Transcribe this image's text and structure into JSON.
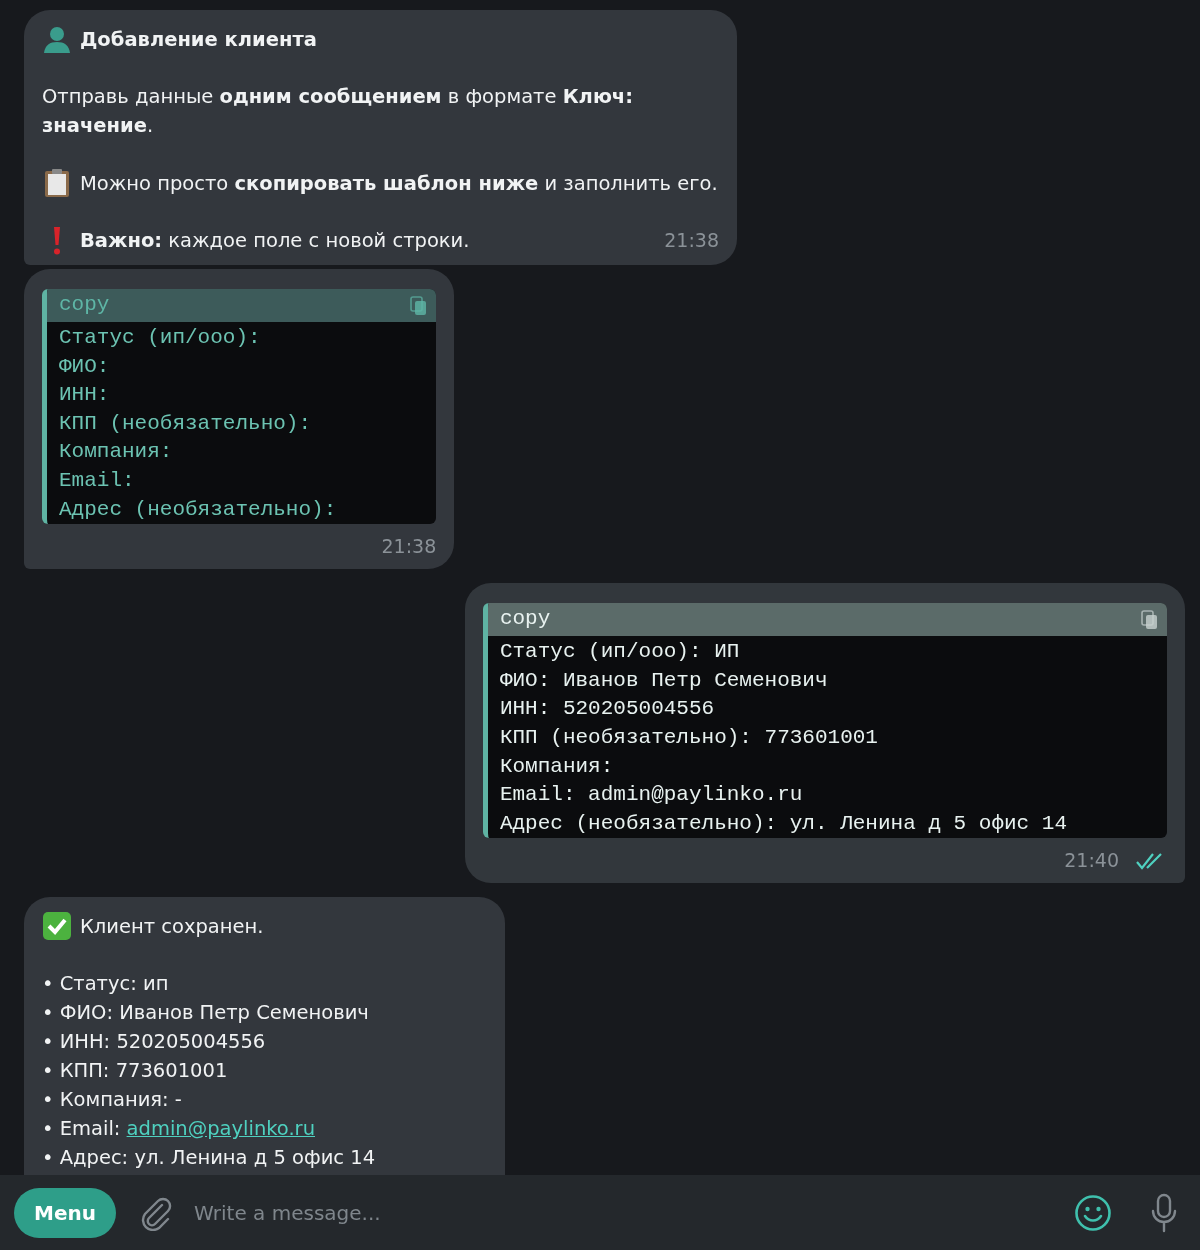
{
  "messages": [
    {
      "kind": "text",
      "outgoing": false,
      "time": "21:38",
      "paragraphs": [
        {
          "kind": "heading",
          "text": "Добавление клиента"
        },
        {
          "kind": "plain",
          "text": "Отправь данные **одним сообщением** в формате **Ключ: значение**."
        },
        {
          "kind": "hint",
          "text": "Можно просто **скопировать шаблон ниже** и заполнить его."
        },
        {
          "kind": "warning",
          "text": "**Важно:** каждое поле с новой строки."
        }
      ]
    },
    {
      "kind": "code",
      "outgoing": false,
      "time": "21:38",
      "header": "copy",
      "lines": [
        "Статус (ип/ооо):",
        "ФИО:",
        "ИНН:",
        "КПП (необязательно):",
        "Компания:",
        "Email:",
        "Адрес (необязательно):"
      ]
    },
    {
      "kind": "code",
      "outgoing": true,
      "read": true,
      "time": "21:40",
      "header": "copy",
      "lines": [
        "Статус (ип/ооо): ИП",
        "ФИО: Иванов Петр Семенович",
        "ИНН: 520205004556",
        "КПП (необязательно): 773601001",
        "Компания:",
        "Email: admin@paylinko.ru",
        "Адрес (необязательно): ул. Ленина д 5 офис 14"
      ]
    },
    {
      "kind": "list",
      "outgoing": false,
      "title": "Клиент сохранен.",
      "items": [
        {
          "text": "• Статус: ип"
        },
        {
          "text": "• ФИО: Иванов Петр Семенович"
        },
        {
          "text": "• ИНН: 520205004556"
        },
        {
          "text": "• КПП: 773601001"
        },
        {
          "text": "• Компания: -"
        },
        {
          "text": "• Email: ",
          "link": "admin@paylinko.ru"
        },
        {
          "text": "• Адрес: ул. Ленина д 5 офис 14"
        }
      ]
    }
  ],
  "composer": {
    "menu_button": "Menu",
    "placeholder": "Write a message..."
  }
}
